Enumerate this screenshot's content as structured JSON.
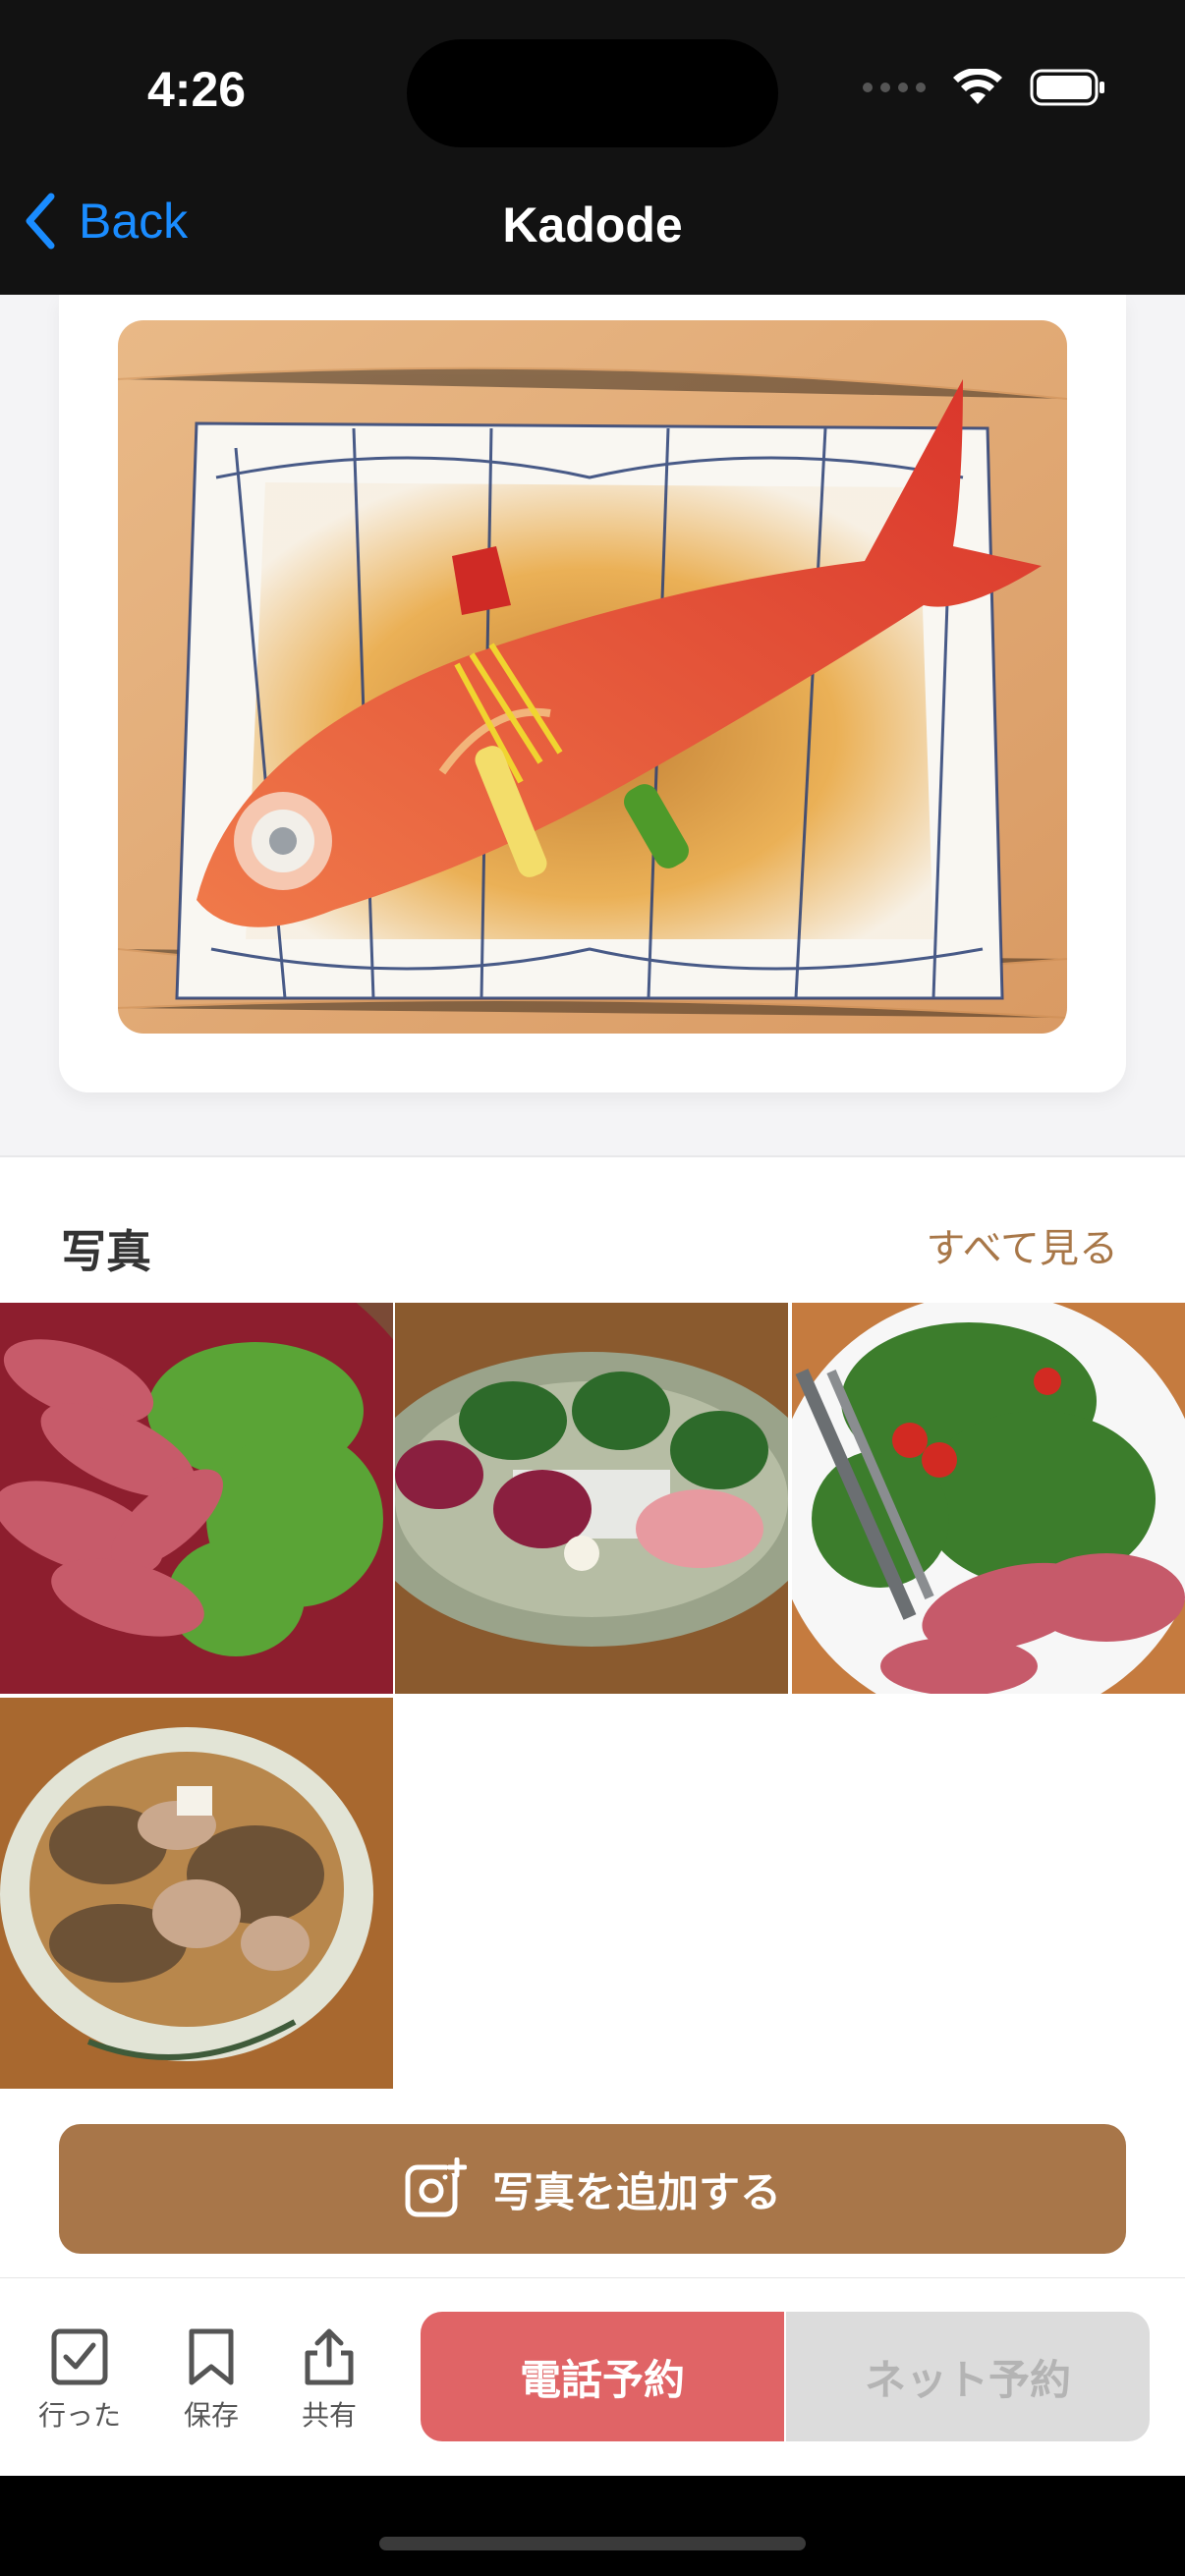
{
  "status_bar": {
    "time": "4:26"
  },
  "nav": {
    "back_label": "Back",
    "title": "Kadode"
  },
  "hero": {
    "alt": "Simmered kinmedai (red snapper) on patterned plate"
  },
  "photos": {
    "title": "写真",
    "see_all": "すべて見る",
    "items": [
      {
        "desc": "Roast beef salad on red plate"
      },
      {
        "desc": "Horse sashimi platter"
      },
      {
        "desc": "Salad with roast beef and tongs"
      },
      {
        "desc": "Motsu nikomi stew bowl"
      }
    ]
  },
  "add_photo_label": "写真を追加する",
  "bottom": {
    "visited": "行った",
    "save": "保存",
    "share": "共有",
    "phone_reserve": "電話予約",
    "net_reserve": "ネット予約"
  },
  "colors": {
    "accent_brown": "#a87649",
    "reserve_red": "#e06466",
    "link_blue": "#1a8cff"
  }
}
